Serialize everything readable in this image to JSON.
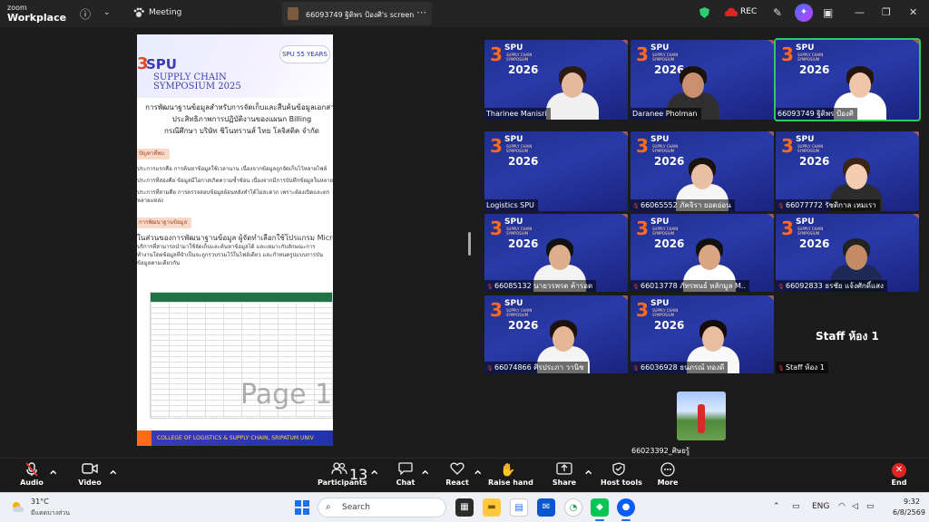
{
  "app": {
    "brand_top": "zoom",
    "brand_bottom": "Workplace",
    "meeting_label": "Meeting",
    "share_tab": "66093749 ฐิติพร ป้องศิ's screen",
    "rec_label": "REC"
  },
  "shared_screen": {
    "badge": "SPU 55 YEARS",
    "logo_num": "3",
    "logo_text": "SPU",
    "symposium_line1": "SUPPLY CHAIN",
    "symposium_line2": "SYMPOSIUM 2025",
    "title_lines": [
      "การพัฒนาฐานข้อมูลสำหรับการจัดเก็บและสืบค้นข้อมูลเอกสาร",
      "ประสิทธิภาพการปฏิบัติงานของแผนก Billing",
      "กรณีศึกษา บริษัท ชิโนทรานส์ ไทย โลจิสติค จำกัด"
    ],
    "section1": "ปัญหาที่พบ",
    "para1": [
      "ประการแรกคือ การค้นหาข้อมูลใช้เวลานาน เนื่องจากข้อมูลถูกจัดเก็บไว้หลายไฟล์",
      "ประการที่สองคือ ข้อมูลมีโอกาสเกิดความซ้ำซ้อน เนื่องจากมีการบันทึกข้อมูลในหลาย",
      "ประการที่สามคือ การตรวจสอบข้อมูลย้อนหลังทำได้ไม่สะดวก เพราะต้องเปิดและตร",
      "หลายแหล่ง"
    ],
    "section2": "การพัฒนาฐานข้อมูล",
    "para2": [
      "ในส่วนของการพัฒนาฐานข้อมูล ผู้จัดทำเลือกใช้โปรแกรม Microsoft Exce",
      "บริการที่สามารถนำมาใช้จัดเก็บและค้นหาข้อมูลได้ และเหมาะกับลักษณะการ",
      "ทำงานโดยข้อมูลที่จำเป็นจะถูกรวบรวมไว้ในไฟล์เดียว และกำหนดรูปแบบการบัน",
      "ข้อมูลตามเดียวกัน"
    ],
    "page_label": "Page 1",
    "footer": "COLLEGE OF LOGISTICS & SUPPLY CHAIN, SRIPATUM UNIV"
  },
  "tile_branding": {
    "num": "3",
    "spu": "SPU",
    "sub1": "SUPPLY CHAIN",
    "sub2": "SYMPOSIUM",
    "year": "2026"
  },
  "participants": [
    {
      "name": "Tharinee Manisri",
      "muted": false
    },
    {
      "name": "Daranee Pholman",
      "muted": false
    },
    {
      "name": "66093749 ฐิติพร ป้องศิ",
      "muted": false
    },
    {
      "name": "Logistics SPU",
      "muted": false
    },
    {
      "name": "66065552 ภัคจิรา ยอดอ่อน",
      "muted": true
    },
    {
      "name": "66077772 รัชติกาล เหมเรา",
      "muted": true
    },
    {
      "name": "66085132 นายวรพรต ค้ารอด",
      "muted": true
    },
    {
      "name": "66013778 ภัทรพนธ์ หลักมูล M..",
      "muted": true
    },
    {
      "name": "66092833 ธรชัย แจ้งศักดิ์แสง",
      "muted": true
    },
    {
      "name": "66074866 ศิรประภา วานิช",
      "muted": true
    },
    {
      "name": "66036928 ธนภรณ์ ทองดี",
      "muted": true
    },
    {
      "name": "Staff ห้อง 1",
      "muted": true
    }
  ],
  "staff_tile_label": "Staff ห้อง 1",
  "self_view_name": "66023392_ศิษยรู้",
  "toolbar": {
    "audio": "Audio",
    "video": "Video",
    "participants": "Participants",
    "participants_count": "13",
    "chat": "Chat",
    "react": "React",
    "raise_hand": "Raise hand",
    "share": "Share",
    "host_tools": "Host tools",
    "more": "More",
    "end": "End"
  },
  "taskbar": {
    "temp": "31°C",
    "weather": "มีแดดบางส่วน",
    "search_placeholder": "Search",
    "lang": "ENG",
    "time": "9:32",
    "date": "6/8/2569"
  }
}
